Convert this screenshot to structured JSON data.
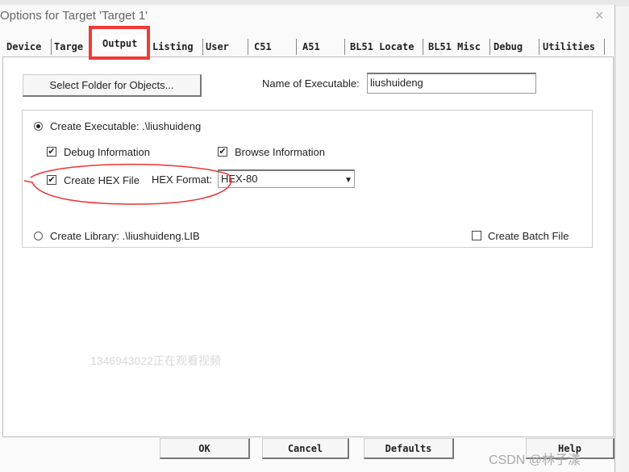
{
  "window": {
    "title": "Options for Target 'Target 1'",
    "close": "×"
  },
  "tabs": [
    {
      "label": "Device",
      "active": false
    },
    {
      "label": "Targe",
      "active": false
    },
    {
      "label": "Output",
      "active": true
    },
    {
      "label": "Listing",
      "active": false
    },
    {
      "label": "User",
      "active": false
    },
    {
      "label": "C51",
      "active": false
    },
    {
      "label": "A51",
      "active": false
    },
    {
      "label": "BL51 Locate",
      "active": false
    },
    {
      "label": "BL51 Misc",
      "active": false
    },
    {
      "label": "Debug",
      "active": false
    },
    {
      "label": "Utilities",
      "active": false
    }
  ],
  "output": {
    "select_folder": "Select Folder for Objects...",
    "name_label": "Name of Executable:",
    "name_value": "liushuideng",
    "create_exe": "Create Executable:  .\\liushuideng",
    "debug_info": "Debug Information",
    "browse_info": "Browse Information",
    "create_hex": "Create HEX File",
    "hex_format_label": "HEX Format:",
    "hex_format_value": "HEX-80",
    "create_lib": "Create Library:  .\\liushuideng.LIB",
    "batch": "Create Batch File",
    "check": "✔"
  },
  "overlay": {
    "watermark": "1346943022正在观看视频",
    "credit": "CSDN @林子漾",
    "highlight_color": "#f03a3a"
  },
  "buttons": {
    "ok": "OK",
    "cancel": "Cancel",
    "defaults": "Defaults",
    "help": "Help"
  }
}
